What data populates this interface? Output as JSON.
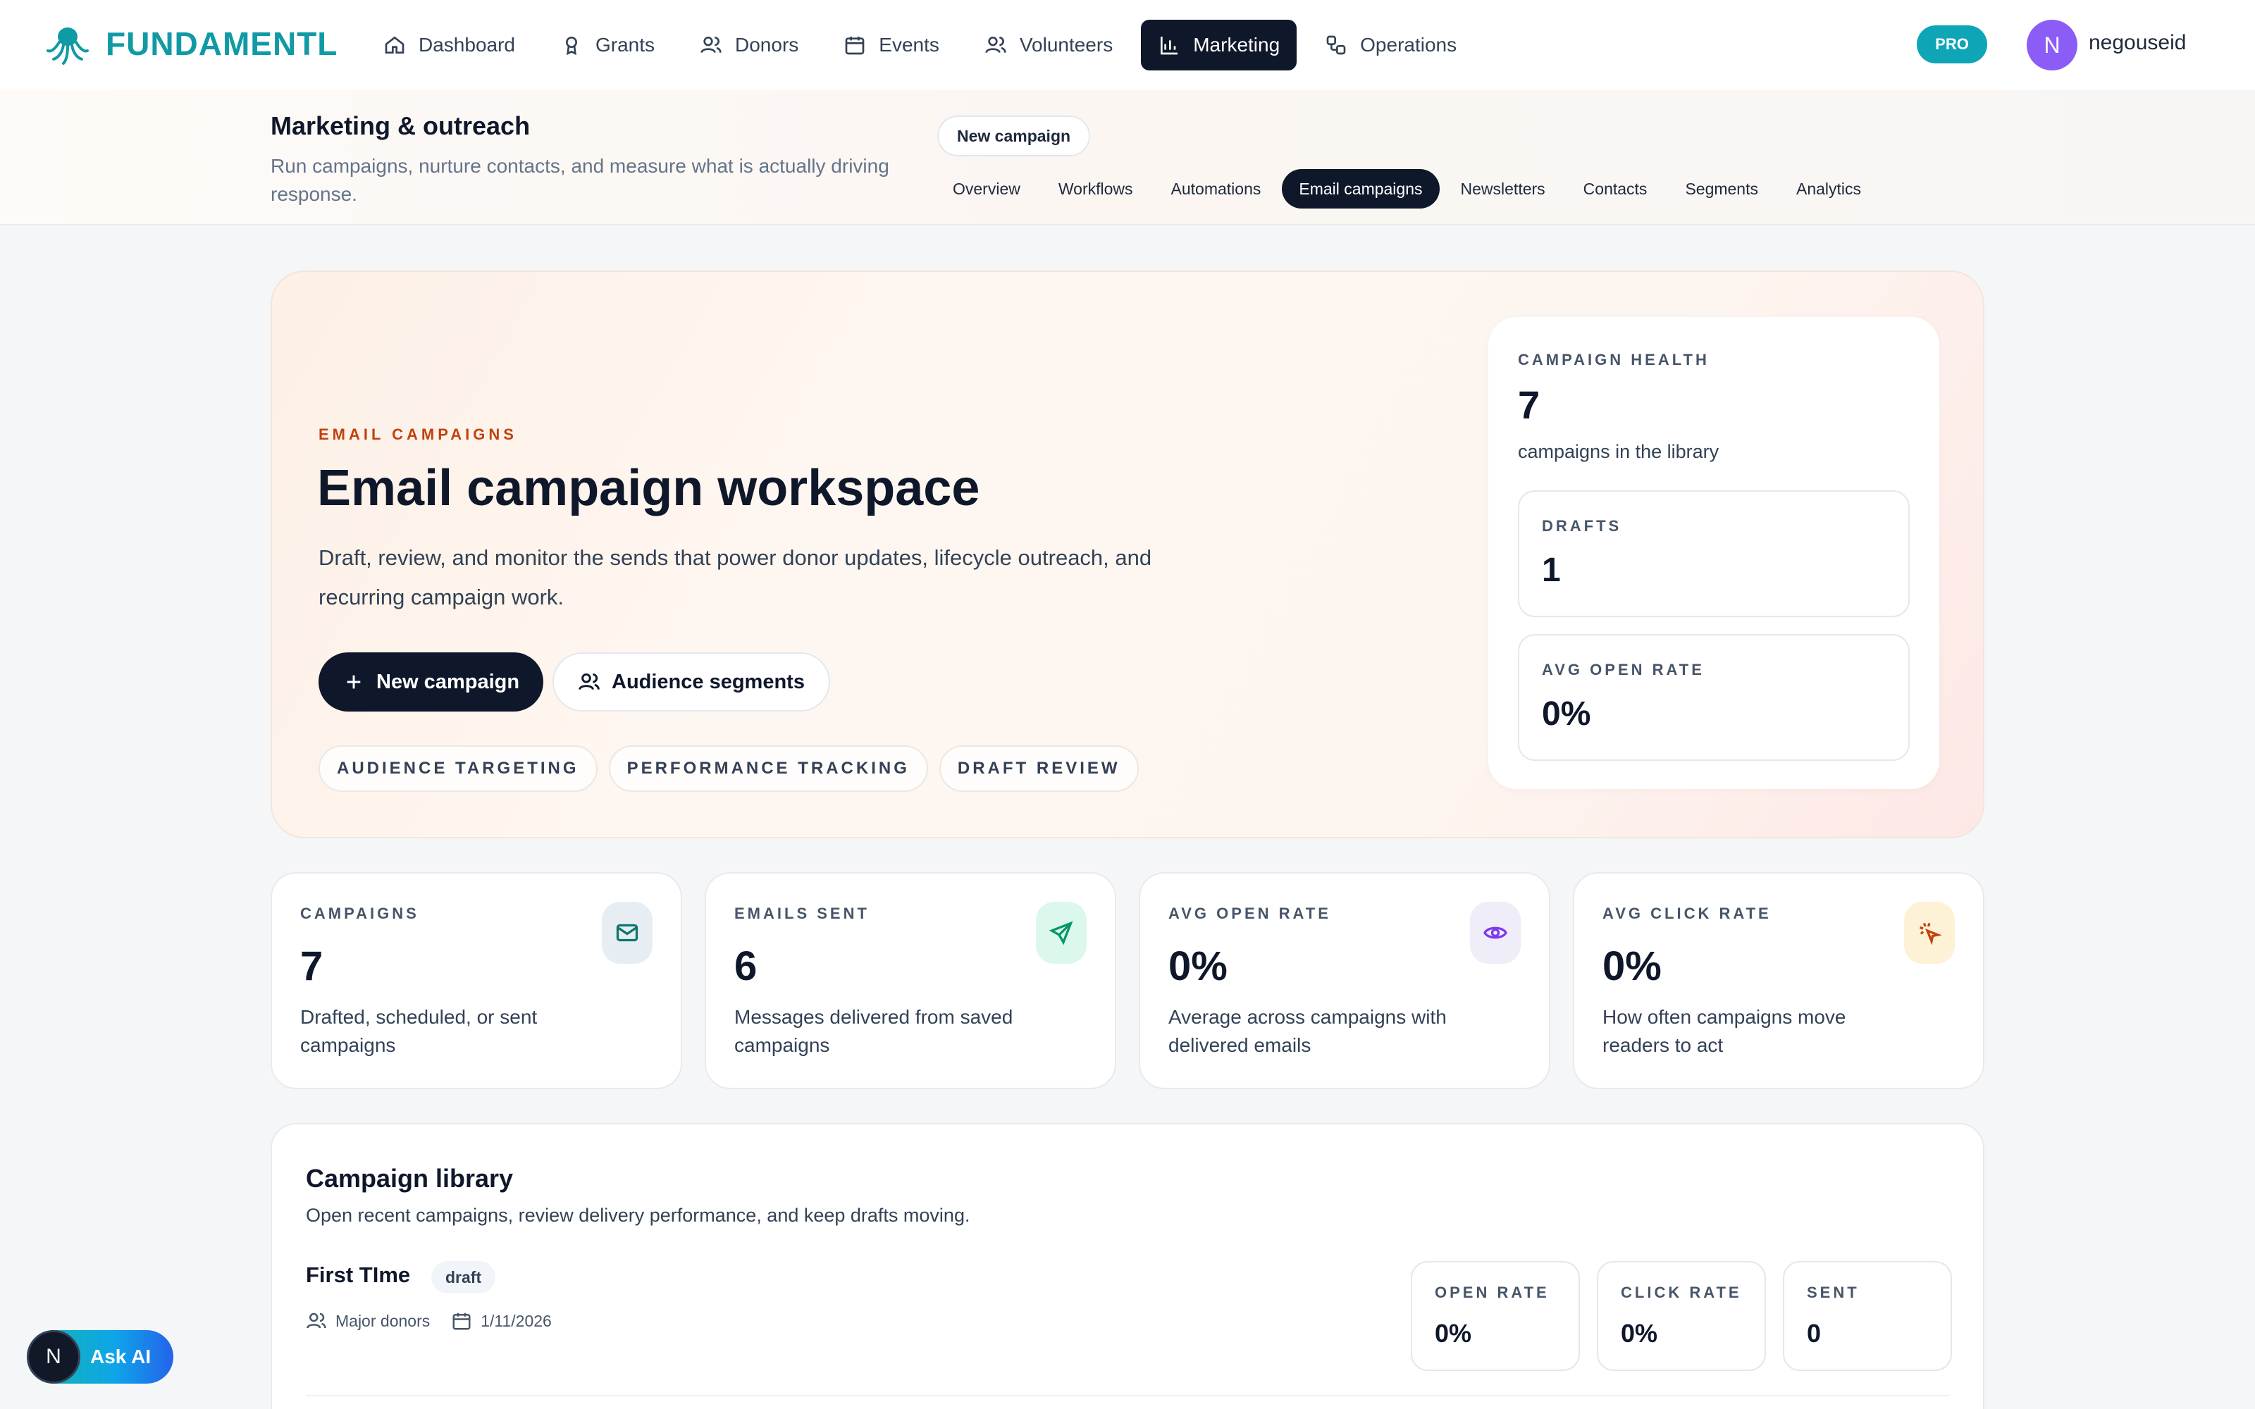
{
  "brand": {
    "name": "FUNDAMENTL",
    "logo_icon": "octopus-icon",
    "color": "#0f9aa5"
  },
  "nav": {
    "items": [
      {
        "label": "Dashboard",
        "icon": "home-icon",
        "active": false
      },
      {
        "label": "Grants",
        "icon": "award-icon",
        "active": false
      },
      {
        "label": "Donors",
        "icon": "users-icon",
        "active": false
      },
      {
        "label": "Events",
        "icon": "calendar-icon",
        "active": false
      },
      {
        "label": "Volunteers",
        "icon": "users-icon",
        "active": false
      },
      {
        "label": "Marketing",
        "icon": "bar-chart-icon",
        "active": true
      },
      {
        "label": "Operations",
        "icon": "workflow-icon",
        "active": false
      }
    ]
  },
  "account": {
    "badge": "PRO",
    "avatar_initial": "N",
    "username": "negouseid",
    "avatar_color": "#8b5cf6"
  },
  "subheader": {
    "title": "Marketing & outreach",
    "description": "Run campaigns, nurture contacts, and measure what is actually driving response.",
    "new_campaign_label": "New campaign",
    "tabs": [
      {
        "label": "Overview",
        "active": false
      },
      {
        "label": "Workflows",
        "active": false
      },
      {
        "label": "Automations",
        "active": false
      },
      {
        "label": "Email campaigns",
        "active": true
      },
      {
        "label": "Newsletters",
        "active": false
      },
      {
        "label": "Contacts",
        "active": false
      },
      {
        "label": "Segments",
        "active": false
      },
      {
        "label": "Analytics",
        "active": false
      }
    ]
  },
  "hero": {
    "eyebrow": "EMAIL CAMPAIGNS",
    "title": "Email campaign workspace",
    "description": "Draft, review, and monitor the sends that power donor updates, lifecycle outreach, and recurring campaign work.",
    "primary_button": "New campaign",
    "secondary_button": "Audience segments",
    "chips": [
      "AUDIENCE TARGETING",
      "PERFORMANCE TRACKING",
      "DRAFT REVIEW"
    ],
    "health": {
      "eyebrow": "CAMPAIGN HEALTH",
      "value": "7",
      "caption": "campaigns in the library",
      "drafts_label": "DRAFTS",
      "drafts_value": "1",
      "open_rate_label": "AVG OPEN RATE",
      "open_rate_value": "0%"
    }
  },
  "stats": [
    {
      "label": "CAMPAIGNS",
      "value": "7",
      "description": "Drafted, scheduled, or sent campaigns",
      "icon": "mail-icon",
      "icon_bg": "#e6eef3",
      "icon_color": "#0f766e"
    },
    {
      "label": "EMAILS SENT",
      "value": "6",
      "description": "Messages delivered from saved campaigns",
      "icon": "send-icon",
      "icon_bg": "#dcf7ec",
      "icon_color": "#059669"
    },
    {
      "label": "AVG OPEN RATE",
      "value": "0%",
      "description": "Average across campaigns with delivered emails",
      "icon": "eye-icon",
      "icon_bg": "#efedf8",
      "icon_color": "#7c3aed"
    },
    {
      "label": "AVG CLICK RATE",
      "value": "0%",
      "description": "How often campaigns move readers to act",
      "icon": "cursor-click-icon",
      "icon_bg": "#fdf1d6",
      "icon_color": "#c2410c"
    }
  ],
  "library": {
    "title": "Campaign library",
    "description": "Open recent campaigns, review delivery performance, and keep drafts moving.",
    "rows": [
      {
        "name": "First TIme",
        "status": "draft",
        "audience": "Major donors",
        "date": "1/11/2026",
        "open_rate_label": "OPEN RATE",
        "open_rate": "0%",
        "click_rate_label": "CLICK RATE",
        "click_rate": "0%",
        "sent_label": "SENT",
        "sent": "0"
      }
    ]
  },
  "ask_ai": {
    "initial": "N",
    "label": "Ask AI"
  }
}
